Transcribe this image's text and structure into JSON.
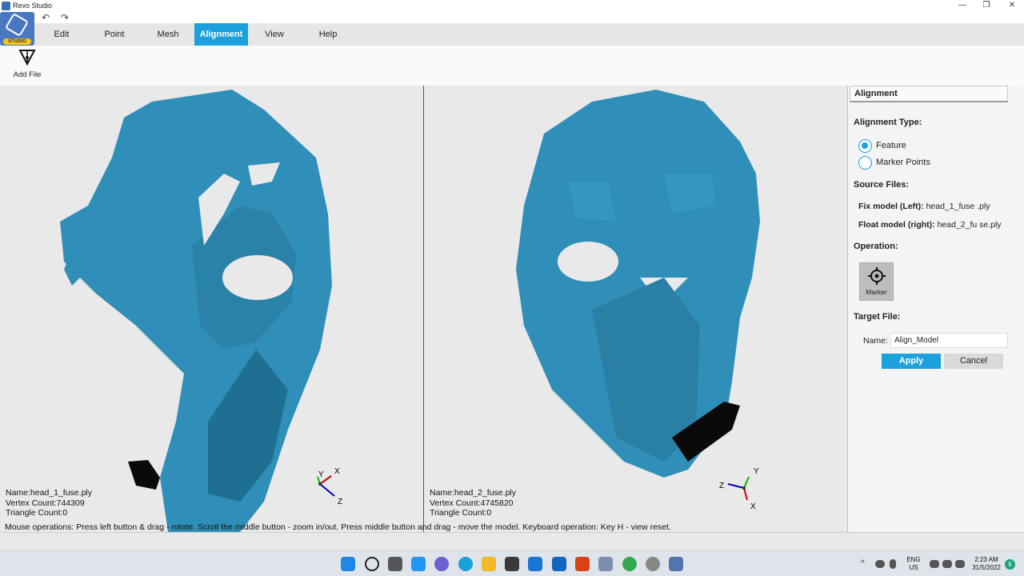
{
  "window": {
    "title": "Revo Studio",
    "minimize": "—",
    "maximize": "❐",
    "close": "✕"
  },
  "quick_access": {
    "undo": "↶",
    "redo": "↷"
  },
  "logo": {
    "badge": "STUDIO"
  },
  "menu": [
    {
      "label": "Edit"
    },
    {
      "label": "Point"
    },
    {
      "label": "Mesh"
    },
    {
      "label": "Alignment"
    },
    {
      "label": "View"
    },
    {
      "label": "Help"
    }
  ],
  "toolbar": {
    "add_file": "Add File"
  },
  "left_model": {
    "name": "Name:head_1_fuse.ply",
    "vertex": "Vertex Count:744309",
    "triangle": "Triangle Count:0"
  },
  "right_model": {
    "name": "Name:head_2_fuse.ply",
    "vertex": "Vertex Count:4745820",
    "triangle": "Triangle Count:0"
  },
  "axes": {
    "x": "X",
    "y": "Y",
    "z": "Z"
  },
  "status": "Mouse operations: Press left button & drag - rotate. Scroll the middle button - zoom in/out. Press middle button and drag - move the model. Keyboard operation: Key H - view reset.",
  "panel": {
    "title": "Alignment",
    "alignment_type_label": "Alignment Type:",
    "options": [
      {
        "label": "Feature",
        "selected": true
      },
      {
        "label": "Marker Points",
        "selected": false
      }
    ],
    "source_files_label": "Source Files:",
    "fix_model_label": "Fix model (Left):",
    "fix_model_value": "head_1_fuse .ply",
    "float_model_label": "Float model (right):",
    "float_model_value": "head_2_fu se.ply",
    "operation_label": "Operation:",
    "marker_label": "Marker",
    "target_file_label": "Target File:",
    "name_label": "Name:",
    "name_value": "Align_Model",
    "apply": "Apply",
    "cancel": "Cancel"
  },
  "tray": {
    "lang_top": "ENG",
    "lang_bottom": "US",
    "time": "2:23 AM",
    "date": "31/5/2022",
    "notifications": "6"
  },
  "colors": {
    "accent": "#1ba1dc",
    "mesh": "#2f8fb8"
  }
}
